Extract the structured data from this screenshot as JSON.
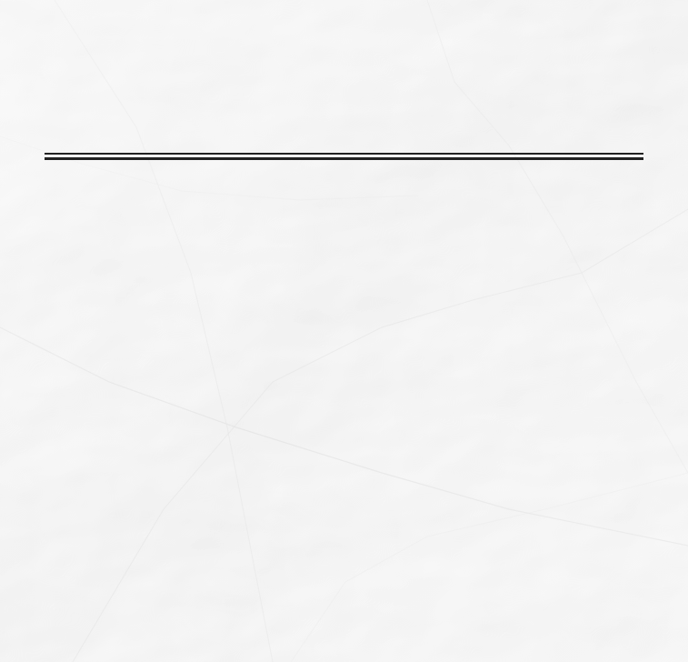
{
  "paper": {
    "base_color": "#f7f7f7",
    "shadow_color": "#e4e4e4",
    "highlight_color": "#ffffff"
  },
  "divider": {
    "color": "#222222"
  }
}
